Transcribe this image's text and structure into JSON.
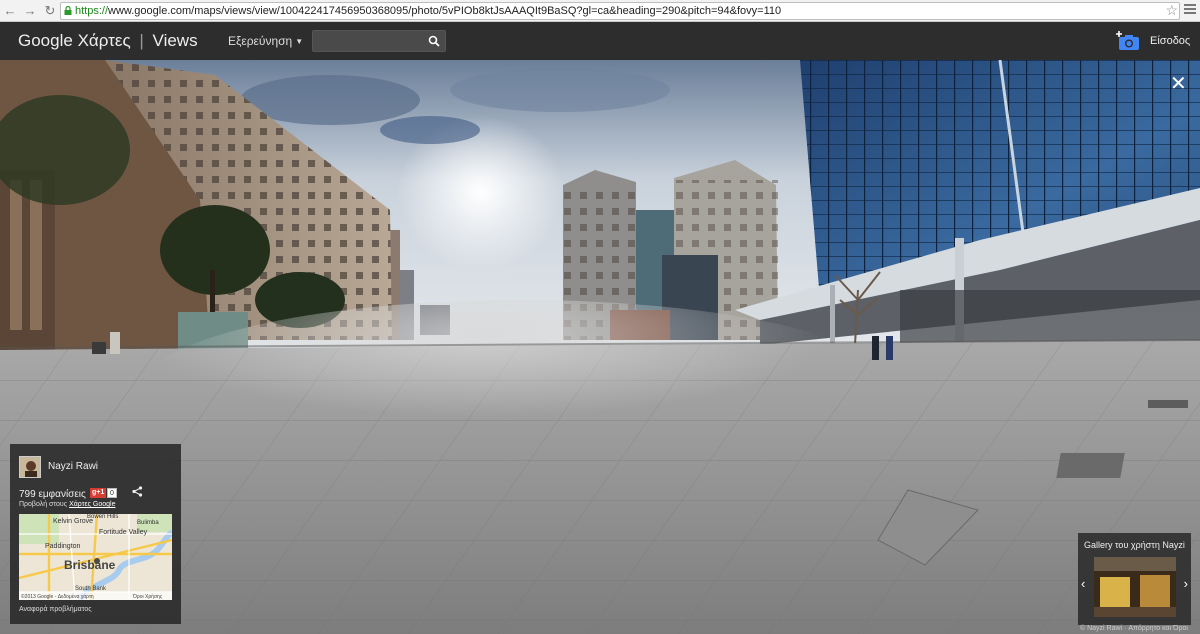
{
  "browser": {
    "url_scheme": "https://",
    "url_rest": "www.google.com/maps/views/view/100422417456950368095/photo/5vPIOb8ktJsAAAQIt9BaSQ?gl=ca&heading=290&pitch=94&fovy=110"
  },
  "header": {
    "logo_google": "Google",
    "logo_maps": "Χάρτες",
    "logo_sep": "|",
    "logo_views": "Views",
    "explore_label": "Εξερεύνηση",
    "search_value": "",
    "signin_label": "Είσοδος"
  },
  "info_panel": {
    "author": "Nayzi Rawi",
    "views_count": "799 εμφανίσεις",
    "gplus_label": "g+1",
    "gplus_count": "0",
    "view_in_prefix": "Προβολή στους",
    "view_in_link": "Χάρτες Google",
    "map_labels": {
      "kelvin_grove": "Kelvin Grove",
      "paddington": "Paddington",
      "fortitude_valley": "Fortitude Valley",
      "brisbane": "Brisbane",
      "bulimba": "Bulimba",
      "bowen_hills": "Bowen Hills",
      "south_bank": "South Bank",
      "copyright": "©2013 Google - Δεδομένα χάρτη",
      "terms": "Όροι Χρήσης"
    },
    "report_label": "Αναφορά προβλήματος"
  },
  "gallery": {
    "title": "Gallery του χρήστη Nayzi Rawi"
  },
  "footer": {
    "text": "© Nayzi Rawi · Απόρρητο και Όροι"
  },
  "colors": {
    "header_bg": "#2d2d2d",
    "accent_blue": "#4285f4",
    "gplus_red": "#d73d32"
  }
}
